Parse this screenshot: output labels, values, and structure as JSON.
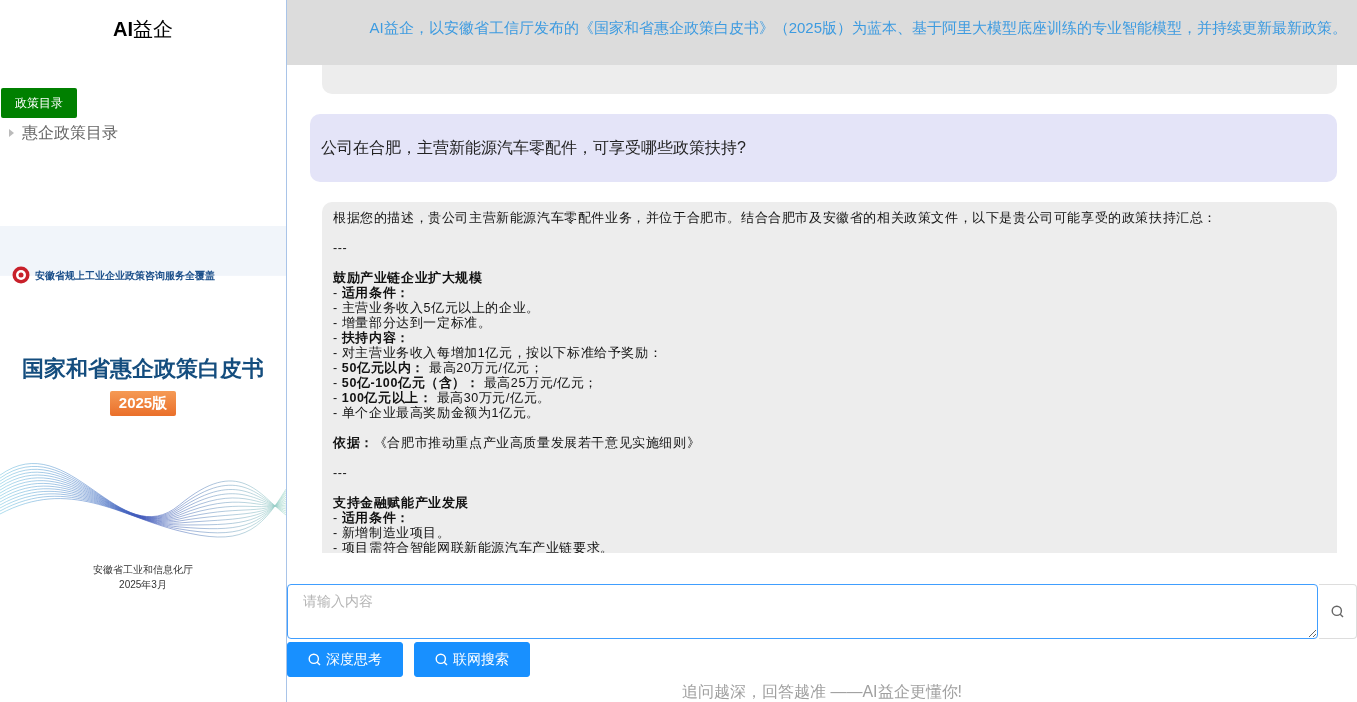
{
  "sidebar": {
    "title": "**AI**益企",
    "button": "政策目录",
    "tree": [
      {
        "label": "惠企政策目录",
        "expanded": false
      }
    ],
    "cover": {
      "org": "安徽省规上工业企业政策咨询服务全覆盖",
      "title": "国家和省惠企政策白皮书",
      "edition": "2025版",
      "publisher": "安徽省工业和信息化厅",
      "date": "2025年3月"
    }
  },
  "header": {
    "text": "AI益企，以安徽省工信厅发布的《国家和省惠企政策白皮书》（2025版）为蓝本、基于阿里大模型底座训练的专业智能模型，并持续更新最新政策。"
  },
  "messages": [
    {
      "kind": "bot-fragment"
    },
    {
      "kind": "user",
      "text": "公司在合肥，主营新能源汽车零配件，可享受哪些政策扶持?"
    },
    {
      "kind": "bot",
      "blocks": [
        [
          {
            "kind": "line",
            "text": "根据您的描述，贵公司主营新能源汽车零配件业务，并位于合肥市。结合合肥市及安徽省的相关政策文件，以下是贵公司可能享受的政策扶持汇总："
          }
        ],
        [
          {
            "kind": "line",
            "text": "---"
          }
        ],
        [
          {
            "kind": "heading",
            "text": "鼓励产业链企业扩大规模"
          },
          {
            "kind": "line",
            "text": "- **适用条件：**"
          },
          {
            "kind": "line",
            "text": "- 主营业务收入5亿元以上的企业。"
          },
          {
            "kind": "line",
            "text": "- 增量部分达到一定标准。"
          },
          {
            "kind": "line",
            "text": "- **扶持内容：**"
          },
          {
            "kind": "line",
            "text": "- 对主营业务收入每增加1亿元，按以下标准给予奖励："
          },
          {
            "kind": "line",
            "text": "- **50亿元以内：** 最高20万元/亿元；"
          },
          {
            "kind": "line",
            "text": "- **50亿-100亿元（含）：** 最高25万元/亿元；"
          },
          {
            "kind": "line",
            "text": "- **100亿元以上：** 最高30万元/亿元。"
          },
          {
            "kind": "line",
            "text": "- 单个企业最高奖励金额为1亿元。"
          }
        ],
        [
          {
            "kind": "line",
            "text": "**依据：**《合肥市推动重点产业高质量发展若干意见实施细则》"
          }
        ],
        [
          {
            "kind": "line",
            "text": "---"
          }
        ],
        [
          {
            "kind": "heading",
            "text": "支持金融赋能产业发展"
          },
          {
            "kind": "line",
            "text": "- **适用条件：**"
          },
          {
            "kind": "line",
            "text": "- 新增制造业项目。"
          },
          {
            "kind": "line",
            "text": "- 项目需符合智能网联新能源汽车产业链要求。"
          }
        ]
      ]
    }
  ],
  "input": {
    "placeholder": "请输入内容"
  },
  "buttons": [
    "深度思考",
    "联网搜索"
  ],
  "footer": "追问越深，回答越准 ——AI益企更懂你!"
}
